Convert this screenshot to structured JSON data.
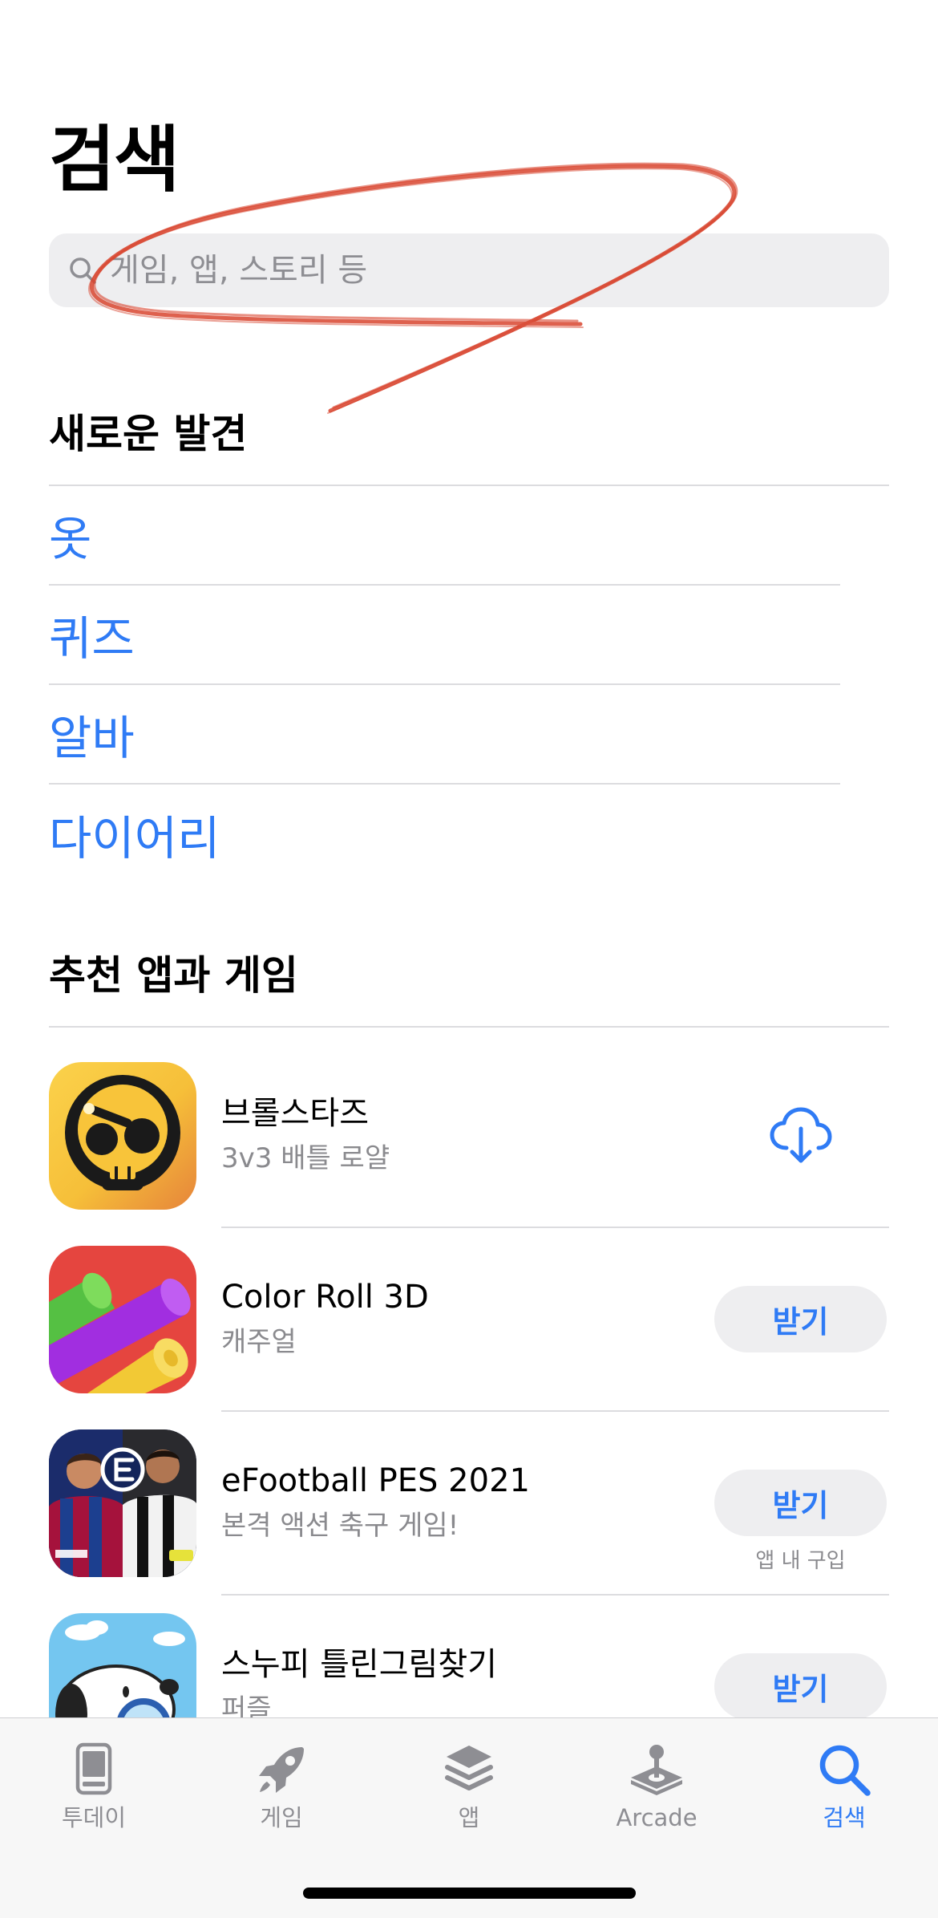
{
  "page": {
    "title": "검색"
  },
  "search": {
    "placeholder": "게임, 앱, 스토리 등",
    "icon": "search-icon"
  },
  "discover": {
    "heading": "새로운 발견",
    "items": [
      "옷",
      "퀴즈",
      "알바",
      "다이어리"
    ]
  },
  "recommended": {
    "heading": "추천 앱과 게임",
    "apps": [
      {
        "name": "브롤스타즈",
        "subtitle": "3v3 배틀 로얄",
        "action_icon": "cloud-download-icon"
      },
      {
        "name": "Color Roll 3D",
        "subtitle": "캐주얼",
        "action_label": "받기"
      },
      {
        "name": "eFootball PES 2021",
        "subtitle": "본격 액션 축구 게임!",
        "action_label": "받기",
        "note": "앱 내 구입"
      },
      {
        "name": "스누피 틀린그림찾기",
        "subtitle": "퍼즐",
        "action_label": "받기"
      }
    ]
  },
  "tab_bar": {
    "tabs": [
      {
        "label": "투데이",
        "icon": "today-icon",
        "active": false
      },
      {
        "label": "게임",
        "icon": "rocket-icon",
        "active": false
      },
      {
        "label": "앱",
        "icon": "apps-stack-icon",
        "active": false
      },
      {
        "label": "Arcade",
        "icon": "joystick-icon",
        "active": false
      },
      {
        "label": "검색",
        "icon": "search-icon",
        "active": true
      }
    ]
  },
  "colors": {
    "accent": "#2f7bf5",
    "secondary_text": "#8a8a8e",
    "tab_inactive": "#8e8e93",
    "annotation": "#d8452f"
  }
}
